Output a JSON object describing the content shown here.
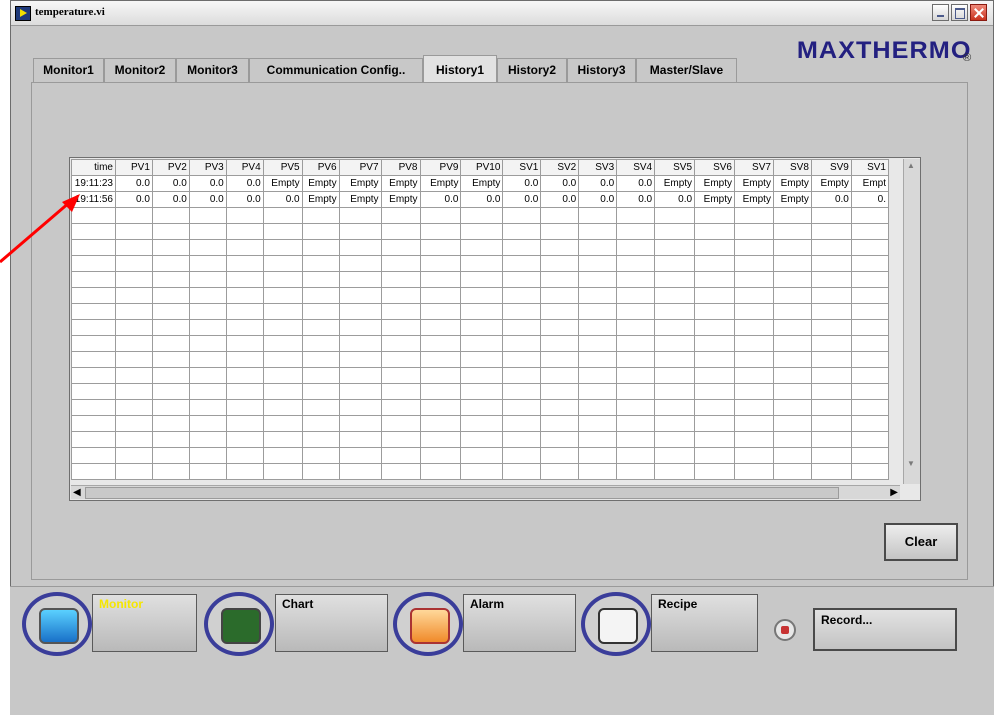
{
  "window": {
    "title": "temperature.vi"
  },
  "brand": {
    "logo_text": "MAXTHERMO",
    "registered_mark": "®"
  },
  "tabs": [
    {
      "label": "Monitor1"
    },
    {
      "label": "Monitor2"
    },
    {
      "label": "Monitor3"
    },
    {
      "label": "Communication Config.."
    },
    {
      "label": "History1",
      "active": true
    },
    {
      "label": "History2"
    },
    {
      "label": "History3"
    },
    {
      "label": "Master/Slave"
    }
  ],
  "table": {
    "columns": [
      "time",
      "PV1",
      "PV2",
      "PV3",
      "PV4",
      "PV5",
      "PV6",
      "PV7",
      "PV8",
      "PV9",
      "PV10",
      "SV1",
      "SV2",
      "SV3",
      "SV4",
      "SV5",
      "SV6",
      "SV7",
      "SV8",
      "SV9",
      "SV1"
    ],
    "rows": [
      [
        "19:11:23",
        "0.0",
        "0.0",
        "0.0",
        "0.0",
        "Empty",
        "Empty",
        "Empty",
        "Empty",
        "Empty",
        "Empty",
        "0.0",
        "0.0",
        "0.0",
        "0.0",
        "Empty",
        "Empty",
        "Empty",
        "Empty",
        "Empty",
        "Empt"
      ],
      [
        "19:11:56",
        "0.0",
        "0.0",
        "0.0",
        "0.0",
        "0.0",
        "Empty",
        "Empty",
        "Empty",
        "0.0",
        "0.0",
        "0.0",
        "0.0",
        "0.0",
        "0.0",
        "0.0",
        "Empty",
        "Empty",
        "Empty",
        "0.0",
        "0."
      ]
    ],
    "empty_rows": 17
  },
  "buttons": {
    "clear": "Clear",
    "record": "Record..."
  },
  "nav": [
    {
      "label": "Monitor",
      "icon": "monitor-icon",
      "active": true
    },
    {
      "label": "Chart",
      "icon": "chart-icon"
    },
    {
      "label": "Alarm",
      "icon": "alarm-icon"
    },
    {
      "label": "Recipe",
      "icon": "recipe-icon"
    }
  ],
  "colors": {
    "active_nav_text": "#f5e600",
    "ring": "#3a3d9a",
    "annotation_arrow": "#ff0000"
  }
}
